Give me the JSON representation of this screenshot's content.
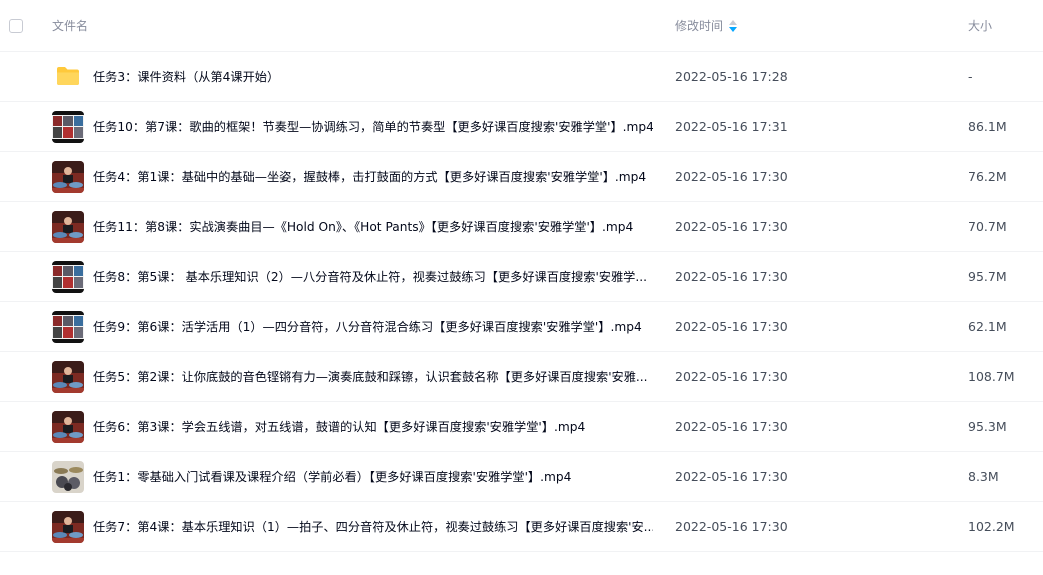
{
  "header": {
    "name_label": "文件名",
    "time_label": "修改时间",
    "size_label": "大小"
  },
  "files": [
    {
      "type": "folder",
      "name": "任务3：课件资料（从第4课开始）",
      "time": "2022-05-16 17:28",
      "size": "-"
    },
    {
      "type": "video",
      "thumb": "grid",
      "name": "任务10：第7课：歌曲的框架！节奏型—协调练习，简单的节奏型【更多好课百度搜索'安雅学堂'】.mp4",
      "time": "2022-05-16 17:31",
      "size": "86.1M"
    },
    {
      "type": "video",
      "thumb": "person",
      "name": "任务4：第1课：基础中的基础—坐姿，握鼓棒，击打鼓面的方式【更多好课百度搜索'安雅学堂'】.mp4",
      "time": "2022-05-16 17:30",
      "size": "76.2M"
    },
    {
      "type": "video",
      "thumb": "person",
      "name": "任务11：第8课：实战演奏曲目—《Hold On》、《Hot Pants》【更多好课百度搜索'安雅学堂'】.mp4",
      "time": "2022-05-16 17:30",
      "size": "70.7M"
    },
    {
      "type": "video",
      "thumb": "grid",
      "name": "任务8：第5课： 基本乐理知识（2）—八分音符及休止符，视奏过鼓练习【更多好课百度搜索'安雅学...",
      "time": "2022-05-16 17:30",
      "size": "95.7M"
    },
    {
      "type": "video",
      "thumb": "grid",
      "name": "任务9：第6课：活学活用（1）—四分音符，八分音符混合练习【更多好课百度搜索'安雅学堂'】.mp4",
      "time": "2022-05-16 17:30",
      "size": "62.1M"
    },
    {
      "type": "video",
      "thumb": "person",
      "name": "任务5：第2课：让你底鼓的音色铿锵有力—演奏底鼓和踩镲，认识套鼓名称【更多好课百度搜索'安雅...",
      "time": "2022-05-16 17:30",
      "size": "108.7M"
    },
    {
      "type": "video",
      "thumb": "person",
      "name": "任务6：第3课：学会五线谱，对五线谱，鼓谱的认知【更多好课百度搜索'安雅学堂'】.mp4",
      "time": "2022-05-16 17:30",
      "size": "95.3M"
    },
    {
      "type": "video",
      "thumb": "drums",
      "name": "任务1：零基础入门试看课及课程介绍（学前必看）【更多好课百度搜索'安雅学堂'】.mp4",
      "time": "2022-05-16 17:30",
      "size": "8.3M"
    },
    {
      "type": "video",
      "thumb": "person",
      "name": "任务7：第4课：基本乐理知识（1）—拍子、四分音符及休止符，视奏过鼓练习【更多好课百度搜索'安...",
      "time": "2022-05-16 17:30",
      "size": "102.2M"
    }
  ],
  "colors": {
    "folder": "#ffc93b",
    "accent": "#06a7ff",
    "thumb_red": "#c0392b",
    "thumb_dark": "#1b1b1f"
  }
}
